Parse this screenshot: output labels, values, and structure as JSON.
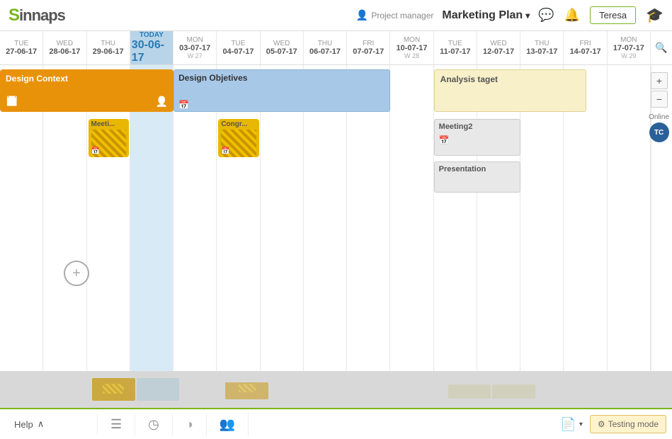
{
  "header": {
    "logo": "Sinnaps",
    "project_manager_label": "Project manager",
    "project_name": "Marketing Plan",
    "chat_icon": "💬",
    "bell_icon": "🔔",
    "user_button": "Teresa",
    "grad_cap": "🎓"
  },
  "calendar": {
    "columns": [
      {
        "id": "tue-2706",
        "day": "TUE",
        "date": "27-06-17",
        "week": "",
        "today": false
      },
      {
        "id": "wed-2806",
        "day": "WED",
        "date": "28-06-17",
        "week": "",
        "today": false
      },
      {
        "id": "thu-2906",
        "day": "THU",
        "date": "29-06-17",
        "week": "",
        "today": false
      },
      {
        "id": "today-3006",
        "day": "Today",
        "date": "30-06-17",
        "week": "",
        "today": true
      },
      {
        "id": "mon-0307",
        "day": "MON",
        "date": "03-07-17",
        "week": "W 27",
        "today": false
      },
      {
        "id": "tue-0407",
        "day": "TUE",
        "date": "04-07-17",
        "week": "",
        "today": false
      },
      {
        "id": "wed-0507",
        "day": "WED",
        "date": "05-07-17",
        "week": "",
        "today": false
      },
      {
        "id": "thu-0607",
        "day": "THU",
        "date": "06-07-17",
        "week": "",
        "today": false
      },
      {
        "id": "fri-0707",
        "day": "FRI",
        "date": "07-07-17",
        "week": "",
        "today": false
      },
      {
        "id": "mon-1007",
        "day": "MON",
        "date": "10-07-17",
        "week": "W 28",
        "today": false
      },
      {
        "id": "tue-1107",
        "day": "TUE",
        "date": "11-07-17",
        "week": "",
        "today": false
      },
      {
        "id": "wed-1207",
        "day": "WED",
        "date": "12-07-17",
        "week": "",
        "today": false
      },
      {
        "id": "thu-1307",
        "day": "THU",
        "date": "13-07-17",
        "week": "",
        "today": false
      },
      {
        "id": "fri-1407",
        "day": "FRI",
        "date": "14-07-17",
        "week": "",
        "today": false
      },
      {
        "id": "mon-1707",
        "day": "MON",
        "date": "17-07-17",
        "week": "W 29",
        "today": false
      }
    ],
    "events": {
      "design_context": {
        "label": "Design Context",
        "bg": "#e8920a",
        "color": "#fff"
      },
      "design_objectives": {
        "label": "Design Objetives",
        "bg": "#a8c8e8",
        "border": "#89b4d8"
      },
      "analysis_target": {
        "label": "Analysis taget",
        "bg": "#f8f0c8",
        "border": "#e0d090"
      },
      "meeting": {
        "label": "Meeti...",
        "bg": "#e8b800"
      },
      "congr": {
        "label": "Congr...",
        "bg": "#e8b800"
      },
      "meeting2": {
        "label": "Meeting2",
        "bg": "#e8e8e8",
        "border": "#ccc"
      },
      "presentation": {
        "label": "Presentation",
        "bg": "#e8e8e8",
        "border": "#ccc"
      }
    }
  },
  "zoom": {
    "plus": "+",
    "minus": "−"
  },
  "online": {
    "label": "Online",
    "badge": "TC"
  },
  "bottom_toolbar": {
    "help": "Help",
    "chevron_up": "∧",
    "list_icon": "≡",
    "clock_icon": "◷",
    "palette_icon": "◉",
    "people_icon": "👥",
    "doc_icon": "📄",
    "testing_label": "Testing mode",
    "testing_icon": "⚙"
  }
}
